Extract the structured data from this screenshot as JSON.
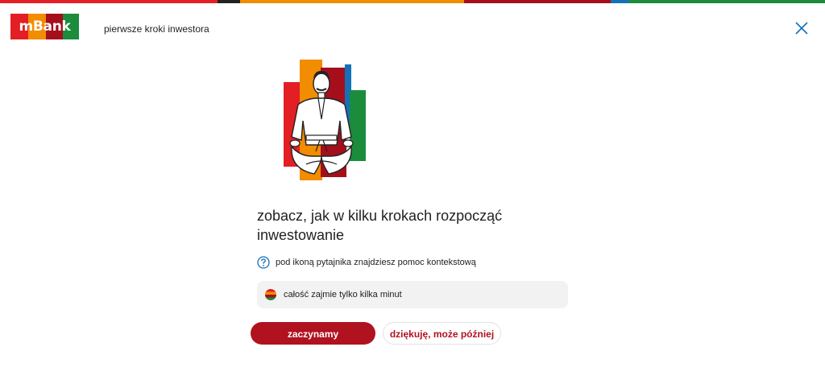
{
  "colors": {
    "red": "#e31e24",
    "orange": "#f28c00",
    "dark_red": "#a50f1c",
    "blue": "#1471b8",
    "green": "#1a8c3c",
    "black": "#222222",
    "primary_button": "#b0121f"
  },
  "header": {
    "logo_text": "mBank",
    "title": "pierwsze kroki inwestora",
    "close_icon": "close-icon"
  },
  "illustration": {
    "icon": "martial-artist-illustration"
  },
  "content": {
    "headline": "zobacz, jak w kilku krokach rozpocząć inwestowanie",
    "help_text": "pod ikoną pytajnika znajdziesz pomoc kontekstową",
    "help_icon": "question-icon",
    "duration_text": "całość zajmie tylko kilka minut",
    "duration_icon": "clock-icon"
  },
  "actions": {
    "start_label": "zaczynamy",
    "later_label": "dziękuję, może później"
  }
}
